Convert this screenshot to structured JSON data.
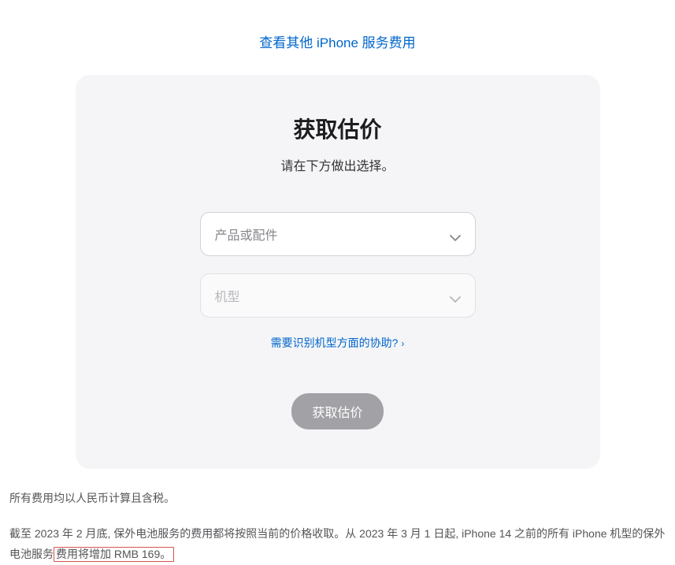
{
  "topLink": {
    "label": "查看其他 iPhone 服务费用"
  },
  "card": {
    "title": "获取估价",
    "subtitle": "请在下方做出选择。",
    "select1": {
      "placeholder": "产品或配件"
    },
    "select2": {
      "placeholder": "机型"
    },
    "helpLink": {
      "label": "需要识别机型方面的协助?"
    },
    "button": {
      "label": "获取估价"
    }
  },
  "footer": {
    "p1": "所有费用均以人民币计算且含税。",
    "p2_a": "截至 2023 年 2 月底, 保外电池服务的费用都将按照当前的价格收取。从 2023 年 3 月 1 日起, iPhone 14 之前的所有 iPhone 机型的保外电池服务",
    "p2_b": "费用将增加 RMB 169。"
  }
}
